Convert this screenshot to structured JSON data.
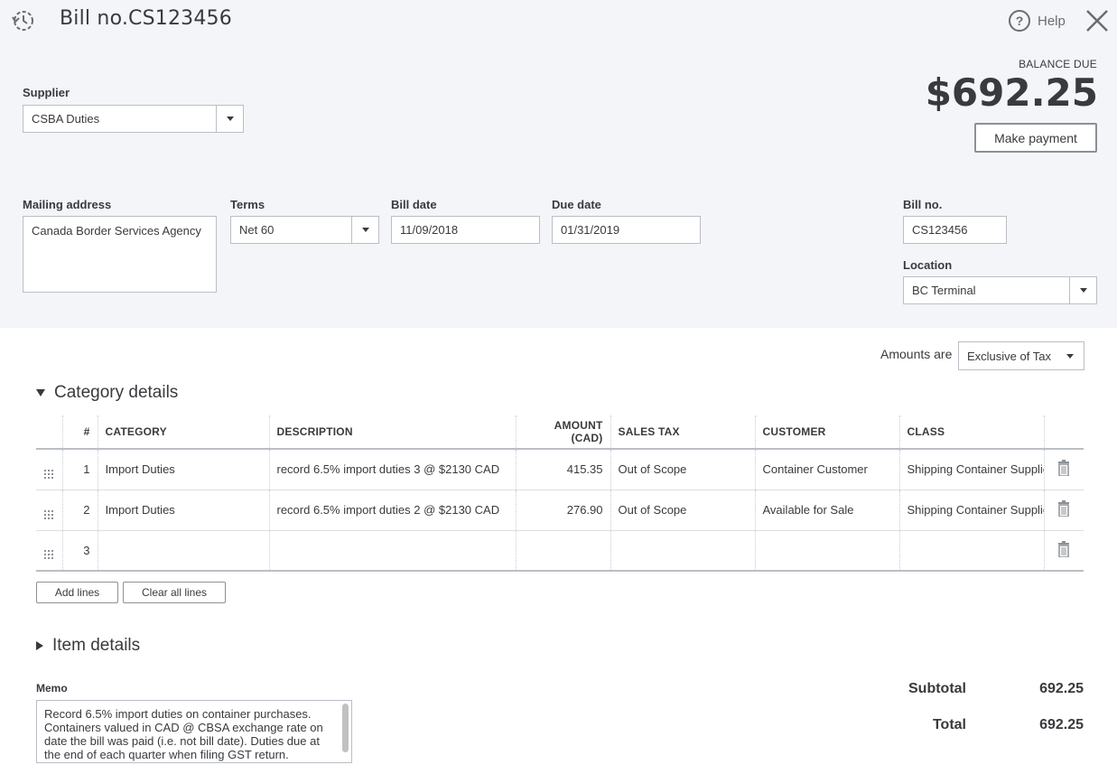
{
  "header": {
    "title": "Bill no.CS123456",
    "help_label": "Help"
  },
  "balance": {
    "label": "BALANCE DUE",
    "amount": "$692.25",
    "pay_button": "Make payment"
  },
  "form": {
    "supplier_label": "Supplier",
    "supplier_value": "CSBA Duties",
    "mailing_label": "Mailing address",
    "mailing_value": "Canada Border Services Agency",
    "terms_label": "Terms",
    "terms_value": "Net 60",
    "bill_date_label": "Bill date",
    "bill_date_value": "11/09/2018",
    "due_date_label": "Due date",
    "due_date_value": "01/31/2019",
    "bill_no_label": "Bill no.",
    "bill_no_value": "CS123456",
    "location_label": "Location",
    "location_value": "BC Terminal"
  },
  "amounts": {
    "label": "Amounts are",
    "value": "Exclusive of Tax"
  },
  "category": {
    "title": "Category details",
    "headers": [
      "#",
      "CATEGORY",
      "DESCRIPTION",
      "AMOUNT (CAD)",
      "SALES TAX",
      "CUSTOMER",
      "CLASS"
    ],
    "rows": [
      {
        "n": "1",
        "category": "Import Duties",
        "description": "record 6.5% import duties 3 @ $2130 CAD",
        "amount": "415.35",
        "tax": "Out of Scope",
        "customer": "Container Customer",
        "class": "Shipping Container Supplies"
      },
      {
        "n": "2",
        "category": "Import Duties",
        "description": "record 6.5% import duties 2 @ $2130 CAD",
        "amount": "276.90",
        "tax": "Out of Scope",
        "customer": "Available for Sale",
        "class": "Shipping Container Supplies"
      },
      {
        "n": "3",
        "category": "",
        "description": "",
        "amount": "",
        "tax": "",
        "customer": "",
        "class": ""
      }
    ],
    "add_lines": "Add lines",
    "clear_lines": "Clear all lines"
  },
  "item": {
    "title": "Item details"
  },
  "memo": {
    "label": "Memo",
    "value": "Record 6.5% import duties on container purchases. Containers valued in CAD @ CBSA exchange rate on date the bill was paid (i.e. not bill date). Duties due at the end of each quarter when filing GST return."
  },
  "totals": {
    "subtotal_label": "Subtotal",
    "subtotal_value": "692.25",
    "total_label": "Total",
    "total_value": "692.25"
  }
}
